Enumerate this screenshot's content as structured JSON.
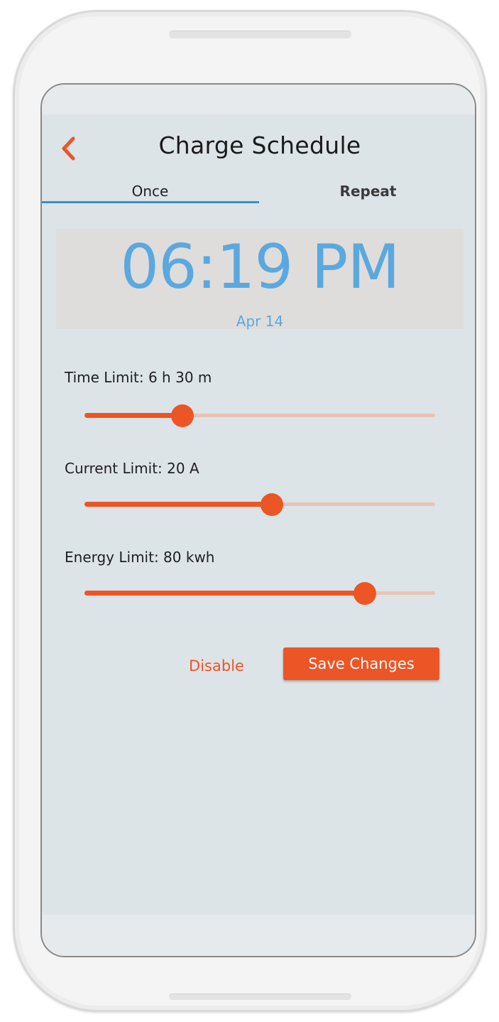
{
  "header": {
    "title": "Charge Schedule",
    "back_icon": "chevron-left-icon"
  },
  "tabs": [
    {
      "label": "Once",
      "active": true
    },
    {
      "label": "Repeat",
      "active": false
    }
  ],
  "schedule": {
    "time": "06:19 PM",
    "date": "Apr 14"
  },
  "limits": {
    "time": {
      "label": "Time Limit: 6 h 30 m",
      "fraction": 0.28
    },
    "current": {
      "label": "Current Limit: 20 A",
      "fraction": 0.535
    },
    "energy": {
      "label": "Energy Limit: 80 kwh",
      "fraction": 0.8
    }
  },
  "actions": {
    "disable_label": "Disable",
    "save_label": "Save Changes"
  },
  "colors": {
    "accent": "#ec5526",
    "time_blue": "#5ba8df",
    "tab_underline": "#3a8fd0",
    "screen_bg": "#dde4e7"
  }
}
